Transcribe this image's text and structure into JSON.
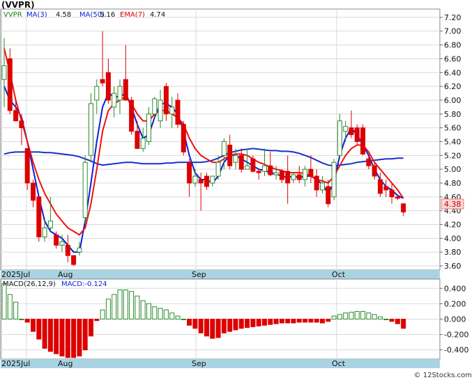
{
  "title": "(VVPR)",
  "indicators": {
    "symbol": "VVPR",
    "ma3_label": "MA(3)",
    "ma3_value": "4.58",
    "ma50_label": "MA(50)",
    "ma50_value": "5.16",
    "ema7_label": "EMA(7)",
    "ema7_value": "4.74"
  },
  "last_price_tag": "4.38",
  "macd_title": {
    "label": "MACD(26,12,9)",
    "value_label": "MACD:-0.124"
  },
  "month_labels": [
    "2025Jul",
    "Aug",
    "Sep",
    "Oct"
  ],
  "watermark": "© 12Stocks.com",
  "colors": {
    "up": "#2a8a2a",
    "down": "#dd0000",
    "ma3": "#0b1fd8",
    "ma50": "#1530cc",
    "ema7": "#ee1111",
    "axisband": "#a9d3e3"
  },
  "chart_data": [
    {
      "type": "candlestick",
      "title": "(VVPR)",
      "y_ticks": [
        3.6,
        3.8,
        4.0,
        4.2,
        4.4,
        4.6,
        4.8,
        5.0,
        5.2,
        5.4,
        5.6,
        5.8,
        6.0,
        6.2,
        6.4,
        6.6,
        6.8,
        7.0,
        7.2
      ],
      "ylim": [
        3.54,
        7.32
      ],
      "candles": [
        {
          "o": 6.3,
          "h": 6.9,
          "l": 5.9,
          "c": 6.5
        },
        {
          "o": 6.6,
          "h": 6.75,
          "l": 5.8,
          "c": 5.85
        },
        {
          "o": 5.85,
          "h": 6.0,
          "l": 5.7,
          "c": 5.7
        },
        {
          "o": 5.7,
          "h": 5.8,
          "l": 5.35,
          "c": 5.6
        },
        {
          "o": 5.3,
          "h": 5.3,
          "l": 4.7,
          "c": 4.8
        },
        {
          "o": 4.8,
          "h": 4.85,
          "l": 4.45,
          "c": 4.55
        },
        {
          "o": 4.6,
          "h": 4.6,
          "l": 3.95,
          "c": 4.02
        },
        {
          "o": 4.02,
          "h": 4.3,
          "l": 3.95,
          "c": 4.15
        },
        {
          "o": 4.15,
          "h": 4.6,
          "l": 4.1,
          "c": 4.25
        },
        {
          "o": 4.05,
          "h": 4.1,
          "l": 3.85,
          "c": 3.9
        },
        {
          "o": 3.9,
          "h": 4.05,
          "l": 3.8,
          "c": 3.95
        },
        {
          "o": 3.9,
          "h": 4.05,
          "l": 3.65,
          "c": 3.75
        },
        {
          "o": 3.75,
          "h": 3.75,
          "l": 3.6,
          "c": 3.62
        },
        {
          "o": 3.8,
          "h": 3.95,
          "l": 3.75,
          "c": 3.86
        },
        {
          "o": 4.3,
          "h": 5.2,
          "l": 4.2,
          "c": 5.1
        },
        {
          "o": 5.2,
          "h": 6.1,
          "l": 5.1,
          "c": 5.95
        },
        {
          "o": 6.0,
          "h": 6.3,
          "l": 5.8,
          "c": 6.2
        },
        {
          "o": 6.3,
          "h": 7.0,
          "l": 6.2,
          "c": 6.25
        },
        {
          "o": 6.4,
          "h": 6.6,
          "l": 5.95,
          "c": 6.0
        },
        {
          "o": 5.9,
          "h": 6.2,
          "l": 5.75,
          "c": 6.1
        },
        {
          "o": 6.0,
          "h": 6.3,
          "l": 5.8,
          "c": 6.2
        },
        {
          "o": 6.3,
          "h": 6.8,
          "l": 6.0,
          "c": 6.0
        },
        {
          "o": 6.0,
          "h": 6.05,
          "l": 5.5,
          "c": 5.55
        },
        {
          "o": 5.55,
          "h": 5.7,
          "l": 5.3,
          "c": 5.3
        },
        {
          "o": 5.3,
          "h": 5.6,
          "l": 5.25,
          "c": 5.45
        },
        {
          "o": 5.4,
          "h": 5.9,
          "l": 5.35,
          "c": 5.8
        },
        {
          "o": 5.8,
          "h": 6.05,
          "l": 5.75,
          "c": 6.02
        },
        {
          "o": 5.7,
          "h": 6.15,
          "l": 5.6,
          "c": 6.0
        },
        {
          "o": 6.2,
          "h": 6.25,
          "l": 5.7,
          "c": 5.8
        },
        {
          "o": 5.8,
          "h": 6.05,
          "l": 5.6,
          "c": 5.9
        },
        {
          "o": 6.0,
          "h": 6.1,
          "l": 5.6,
          "c": 5.65
        },
        {
          "o": 5.65,
          "h": 5.7,
          "l": 5.2,
          "c": 5.25
        },
        {
          "o": 5.1,
          "h": 5.15,
          "l": 4.6,
          "c": 4.8
        },
        {
          "o": 4.8,
          "h": 5.0,
          "l": 4.75,
          "c": 4.9
        },
        {
          "o": 4.85,
          "h": 4.95,
          "l": 4.4,
          "c": 4.8
        },
        {
          "o": 4.9,
          "h": 4.95,
          "l": 4.7,
          "c": 4.75
        },
        {
          "o": 4.8,
          "h": 4.9,
          "l": 4.75,
          "c": 4.9
        },
        {
          "o": 4.9,
          "h": 5.2,
          "l": 4.85,
          "c": 5.1
        },
        {
          "o": 5.2,
          "h": 5.45,
          "l": 5.0,
          "c": 5.4
        },
        {
          "o": 5.35,
          "h": 5.5,
          "l": 5.0,
          "c": 5.05
        },
        {
          "o": 5.1,
          "h": 5.3,
          "l": 5.0,
          "c": 5.2
        },
        {
          "o": 5.2,
          "h": 5.3,
          "l": 4.95,
          "c": 5.0
        },
        {
          "o": 5.0,
          "h": 5.3,
          "l": 5.0,
          "c": 5.05
        },
        {
          "o": 5.15,
          "h": 5.2,
          "l": 4.95,
          "c": 4.97
        },
        {
          "o": 4.97,
          "h": 5.0,
          "l": 4.85,
          "c": 4.95
        },
        {
          "o": 4.97,
          "h": 5.3,
          "l": 4.9,
          "c": 5.05
        },
        {
          "o": 5.05,
          "h": 5.25,
          "l": 4.9,
          "c": 4.92
        },
        {
          "o": 4.92,
          "h": 5.05,
          "l": 4.85,
          "c": 4.95
        },
        {
          "o": 4.97,
          "h": 5.0,
          "l": 4.8,
          "c": 4.85
        },
        {
          "o": 4.97,
          "h": 5.2,
          "l": 4.5,
          "c": 4.8
        },
        {
          "o": 4.85,
          "h": 4.95,
          "l": 4.8,
          "c": 4.92
        },
        {
          "o": 4.92,
          "h": 5.05,
          "l": 4.8,
          "c": 4.85
        },
        {
          "o": 4.85,
          "h": 5.05,
          "l": 4.75,
          "c": 5.0
        },
        {
          "o": 5.0,
          "h": 5.2,
          "l": 4.8,
          "c": 4.9
        },
        {
          "o": 4.9,
          "h": 5.0,
          "l": 4.6,
          "c": 4.7
        },
        {
          "o": 4.7,
          "h": 4.9,
          "l": 4.65,
          "c": 4.8
        },
        {
          "o": 4.75,
          "h": 4.85,
          "l": 4.45,
          "c": 4.5
        },
        {
          "o": 4.6,
          "h": 5.15,
          "l": 4.55,
          "c": 5.1
        },
        {
          "o": 5.2,
          "h": 5.8,
          "l": 5.15,
          "c": 5.7
        },
        {
          "o": 5.55,
          "h": 5.7,
          "l": 5.4,
          "c": 5.62
        },
        {
          "o": 5.6,
          "h": 5.85,
          "l": 5.45,
          "c": 5.5
        },
        {
          "o": 5.6,
          "h": 5.65,
          "l": 5.35,
          "c": 5.4
        },
        {
          "o": 5.6,
          "h": 5.65,
          "l": 5.2,
          "c": 5.22
        },
        {
          "o": 5.15,
          "h": 5.2,
          "l": 5.0,
          "c": 5.05
        },
        {
          "o": 5.05,
          "h": 5.1,
          "l": 4.85,
          "c": 4.9
        },
        {
          "o": 4.85,
          "h": 4.95,
          "l": 4.6,
          "c": 4.65
        },
        {
          "o": 4.75,
          "h": 4.85,
          "l": 4.6,
          "c": 4.7
        },
        {
          "o": 4.7,
          "h": 4.8,
          "l": 4.5,
          "c": 4.6
        },
        {
          "o": 4.6,
          "h": 4.6,
          "l": 4.55,
          "c": 4.58
        },
        {
          "o": 4.5,
          "h": 4.5,
          "l": 4.32,
          "c": 4.38
        }
      ],
      "series": [
        {
          "name": "MA(3)",
          "values": [
            6.2,
            6.0,
            5.9,
            5.75,
            5.4,
            5.0,
            4.6,
            4.25,
            4.1,
            4.05,
            4.0,
            3.9,
            3.8,
            3.8,
            4.25,
            4.8,
            5.4,
            5.9,
            6.1,
            6.05,
            6.05,
            6.1,
            5.9,
            5.65,
            5.45,
            5.5,
            5.75,
            5.95,
            5.95,
            5.9,
            5.8,
            5.55,
            5.2,
            4.95,
            4.85,
            4.85,
            4.8,
            4.9,
            5.1,
            5.2,
            5.2,
            5.15,
            5.1,
            5.05,
            5.0,
            4.98,
            4.95,
            4.93,
            4.9,
            4.88,
            4.9,
            4.88,
            4.9,
            4.9,
            4.85,
            4.78,
            4.65,
            4.8,
            5.2,
            5.45,
            5.6,
            5.5,
            5.35,
            5.2,
            5.0,
            4.85,
            4.75,
            4.7,
            4.62,
            4.58
          ]
        },
        {
          "name": "MA(50)",
          "values": [
            5.22,
            5.24,
            5.25,
            5.25,
            5.25,
            5.25,
            5.25,
            5.24,
            5.24,
            5.23,
            5.22,
            5.21,
            5.2,
            5.18,
            5.15,
            5.12,
            5.08,
            5.06,
            5.07,
            5.08,
            5.09,
            5.1,
            5.1,
            5.09,
            5.08,
            5.08,
            5.08,
            5.08,
            5.09,
            5.09,
            5.1,
            5.1,
            5.1,
            5.1,
            5.1,
            5.11,
            5.13,
            5.16,
            5.2,
            5.24,
            5.26,
            5.28,
            5.29,
            5.3,
            5.29,
            5.28,
            5.27,
            5.27,
            5.26,
            5.26,
            5.25,
            5.23,
            5.2,
            5.17,
            5.13,
            5.09,
            5.06,
            5.05,
            5.06,
            5.07,
            5.08,
            5.1,
            5.11,
            5.12,
            5.13,
            5.14,
            5.15,
            5.15,
            5.16,
            5.16
          ]
        },
        {
          "name": "EMA(7)",
          "values": [
            6.75,
            6.4,
            6.0,
            5.7,
            5.4,
            5.1,
            4.85,
            4.65,
            4.5,
            4.35,
            4.25,
            4.15,
            4.1,
            4.05,
            4.15,
            4.5,
            5.0,
            5.55,
            5.85,
            5.95,
            6.0,
            6.05,
            5.95,
            5.8,
            5.7,
            5.7,
            5.8,
            5.85,
            5.85,
            5.8,
            5.75,
            5.65,
            5.45,
            5.3,
            5.2,
            5.15,
            5.1,
            5.1,
            5.15,
            5.2,
            5.22,
            5.22,
            5.2,
            5.15,
            5.1,
            5.07,
            5.03,
            5.0,
            4.98,
            4.95,
            4.95,
            4.95,
            4.94,
            4.9,
            4.85,
            4.83,
            4.8,
            4.9,
            5.05,
            5.2,
            5.3,
            5.35,
            5.35,
            5.25,
            5.1,
            5.0,
            4.9,
            4.8,
            4.7,
            4.58
          ]
        }
      ]
    },
    {
      "type": "bar",
      "title": "MACD(26,12,9)",
      "y_ticks": [
        -0.4,
        -0.2,
        0.0,
        0.2,
        0.4
      ],
      "ylim": [
        -0.52,
        0.52
      ],
      "values": [
        0.46,
        0.32,
        0.22,
        0.0,
        -0.04,
        -0.16,
        -0.26,
        -0.38,
        -0.42,
        -0.45,
        -0.48,
        -0.5,
        -0.5,
        -0.48,
        -0.4,
        -0.22,
        -0.02,
        0.12,
        0.26,
        0.32,
        0.38,
        0.38,
        0.36,
        0.3,
        0.24,
        0.2,
        0.16,
        0.14,
        0.12,
        0.08,
        0.04,
        0.0,
        -0.08,
        -0.12,
        -0.18,
        -0.22,
        -0.25,
        -0.24,
        -0.18,
        -0.16,
        -0.14,
        -0.12,
        -0.11,
        -0.1,
        -0.09,
        -0.08,
        -0.07,
        -0.06,
        -0.05,
        -0.05,
        -0.05,
        -0.04,
        -0.04,
        -0.04,
        -0.04,
        -0.05,
        -0.03,
        0.04,
        0.06,
        0.08,
        0.09,
        0.1,
        0.1,
        0.08,
        0.06,
        0.03,
        0.0,
        -0.03,
        -0.06,
        -0.12
      ]
    }
  ]
}
